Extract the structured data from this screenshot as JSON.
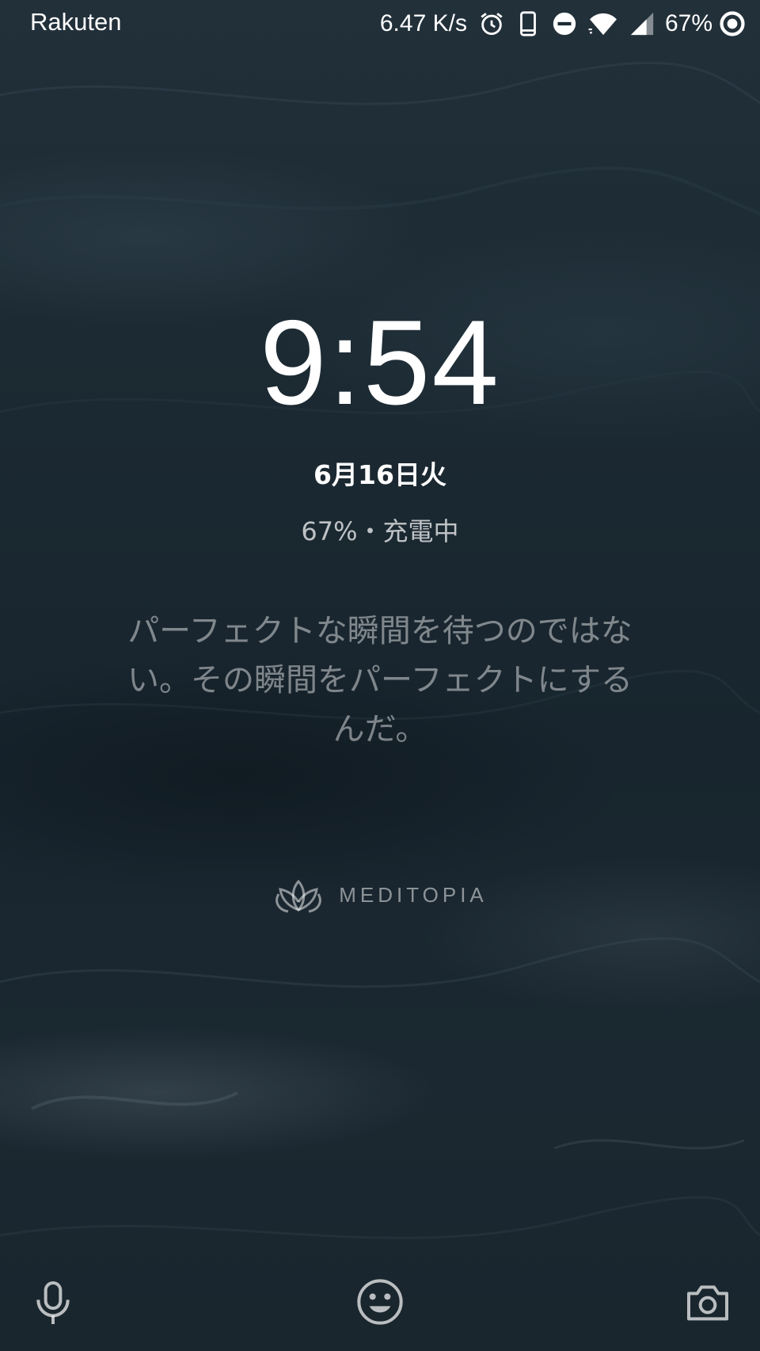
{
  "status_bar": {
    "carrier": "Rakuten",
    "net_speed": "6.47 K/s",
    "battery_percent": "67%",
    "icons": [
      "alarm-icon",
      "phone-icon",
      "do-not-disturb-icon",
      "wifi-icon",
      "cell-signal-icon",
      "data-saver-icon"
    ]
  },
  "lockscreen": {
    "time": "9:54",
    "date": "6月16日火",
    "battery_status": "67%・充電中",
    "quote": "パーフェクトな瞬間を待つのではない。その瞬間をパーフェクトにするんだ。",
    "brand": "MEDITOPIA"
  },
  "bottom": {
    "icons": [
      "microphone-icon",
      "smiley-icon",
      "camera-icon"
    ]
  },
  "colors": {
    "wallpaper": "#1c2a33",
    "text": "#ffffff"
  }
}
